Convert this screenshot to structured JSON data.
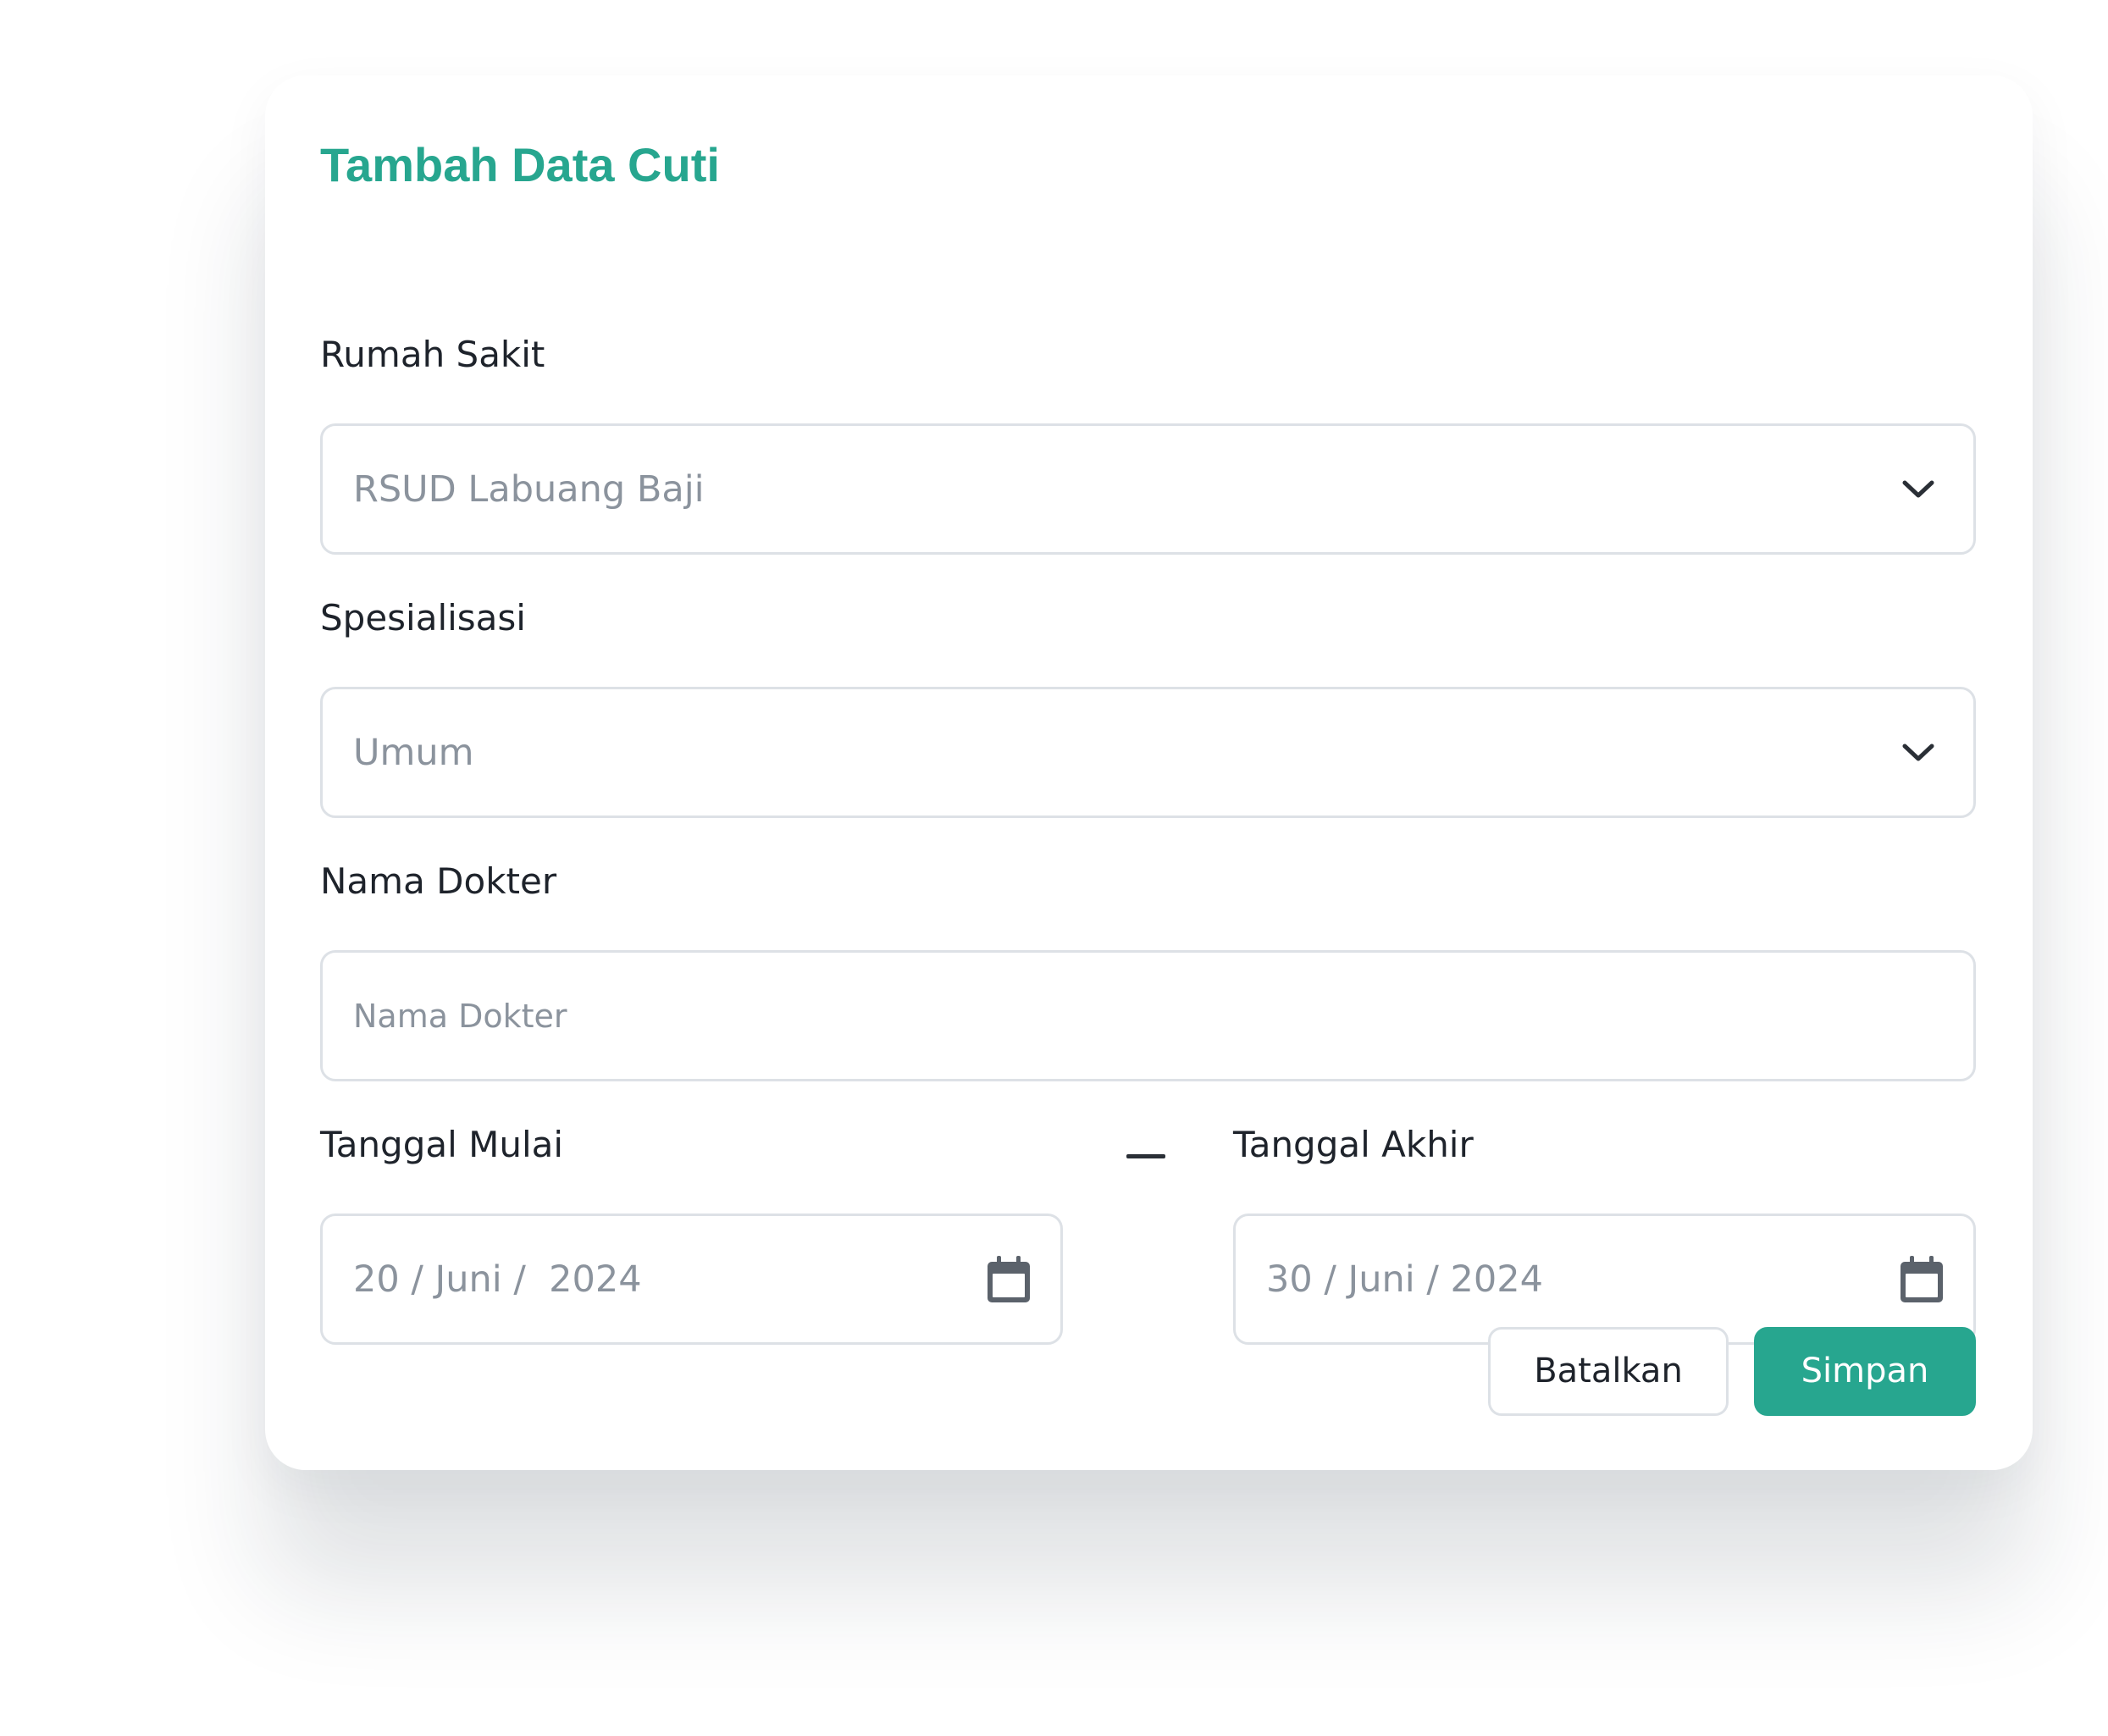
{
  "form": {
    "title": "Tambah Data Cuti",
    "hospital": {
      "label": "Rumah Sakit",
      "value": "RSUD Labuang Baji",
      "icon": "chevron-down-icon"
    },
    "specialization": {
      "label": "Spesialisasi",
      "value": "Umum",
      "icon": "chevron-down-icon"
    },
    "doctor_name": {
      "label": "Nama Dokter",
      "value": "",
      "placeholder": "Nama Dokter"
    },
    "start_date": {
      "label": "Tanggal Mulai",
      "value": "20 / Juni /  2024",
      "icon": "calendar-icon"
    },
    "end_date": {
      "label": "Tanggal Akhir",
      "value": "30 / Juni / 2024",
      "icon": "calendar-icon"
    },
    "range_separator": "—",
    "buttons": {
      "cancel_label": "Batalkan",
      "save_label": "Simpan"
    }
  },
  "colors": {
    "accent": "#27a68f",
    "text": "#1e232b",
    "muted_text": "#8b939d",
    "border": "#dde1e6",
    "icon": "#5b626b"
  }
}
